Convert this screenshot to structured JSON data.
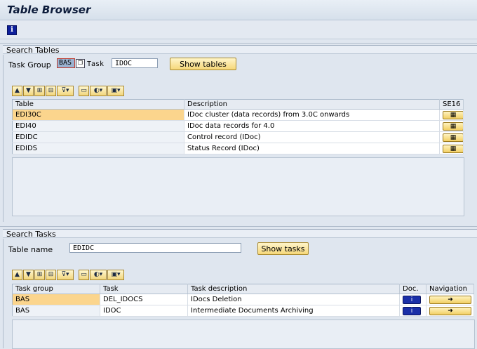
{
  "window": {
    "title": "Table Browser"
  },
  "app_toolbar": {
    "info_icon": "info-icon",
    "info_glyph": "i"
  },
  "search_tables": {
    "header": "Search Tables",
    "task_group_label": "Task Group",
    "task_group_value": "BAS",
    "task_label": "Task",
    "task_value": "IDOC",
    "show_button": "Show tables",
    "columns": [
      "Table",
      "Description",
      "SE16"
    ],
    "rows": [
      {
        "table": "EDI30C",
        "description": "IDoc cluster (data records) from 3.0C onwards"
      },
      {
        "table": "EDI40",
        "description": "IDoc data records for 4.0"
      },
      {
        "table": "EDIDC",
        "description": "Control record (IDoc)"
      },
      {
        "table": "EDIDS",
        "description": "Status Record (IDoc)"
      }
    ]
  },
  "search_tasks": {
    "header": "Search Tasks",
    "table_name_label": "Table name",
    "table_name_value": "EDIDC",
    "show_button": "Show tasks",
    "columns": [
      "Task group",
      "Task",
      "Task description",
      "Doc.",
      "Navigation"
    ],
    "rows": [
      {
        "task_group": "BAS",
        "task": "DEL_IDOCS",
        "description": "IDocs Deletion"
      },
      {
        "task_group": "BAS",
        "task": "IDOC",
        "description": "Intermediate Documents Archiving"
      }
    ]
  },
  "colors": {
    "selected_cell": "#fbd58d",
    "button_yellow": "#f6d77a",
    "info_blue": "#0d1f9b"
  }
}
